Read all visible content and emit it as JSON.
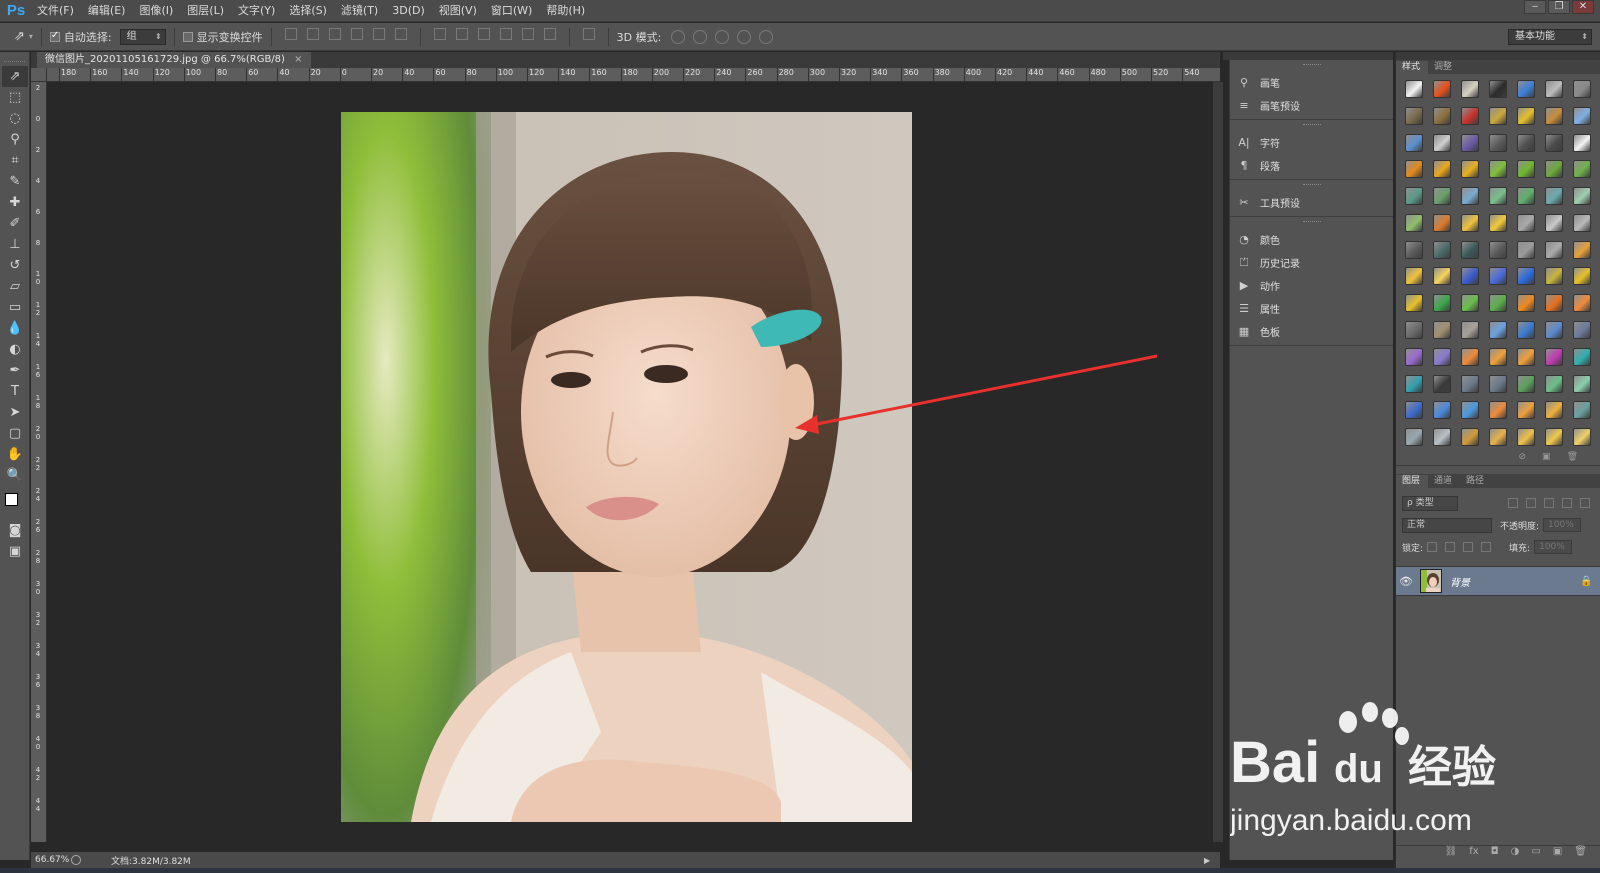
{
  "app": {
    "logo": "Ps"
  },
  "menu": [
    "文件(F)",
    "编辑(E)",
    "图像(I)",
    "图层(L)",
    "文字(Y)",
    "选择(S)",
    "滤镜(T)",
    "3D(D)",
    "视图(V)",
    "窗口(W)",
    "帮助(H)"
  ],
  "window_controls": [
    "‒",
    "❐",
    "✕"
  ],
  "options_bar": {
    "auto_select_label": "自动选择:",
    "auto_select_checked": true,
    "auto_select_value": "组",
    "show_transform_label": "显示变换控件",
    "show_transform_checked": false,
    "mode_3d_label": "3D 模式:",
    "workspace": "基本功能"
  },
  "document": {
    "tab_title": "微信图片_20201105161729.jpg @ 66.7%(RGB/8)",
    "tab_close": "×",
    "ruler_top_ticks": [
      "180",
      "160",
      "140",
      "120",
      "100",
      "80",
      "60",
      "40",
      "20",
      "0",
      "20",
      "40",
      "60",
      "80",
      "100",
      "120",
      "140",
      "160",
      "180",
      "200",
      "220",
      "240",
      "260",
      "280",
      "300",
      "320",
      "340",
      "360",
      "380",
      "400",
      "420",
      "440",
      "460",
      "480",
      "500",
      "520",
      "540"
    ],
    "ruler_left_ticks": [
      "2",
      "0",
      "2",
      "4",
      "6",
      "8",
      "1 0",
      "1 2",
      "1 4",
      "1 6",
      "1 8",
      "2 0",
      "2 2",
      "2 4",
      "2 6",
      "2 8",
      "3 0",
      "3 2",
      "3 4",
      "3 6",
      "3 8",
      "4 0",
      "4 2",
      "4 4"
    ]
  },
  "status": {
    "zoom": "66.67%",
    "doc_size": "文档:3.82M/3.82M"
  },
  "mid_panel": {
    "groups": [
      [
        {
          "icon": "brush-icon",
          "glyph": "⚲",
          "label": "画笔"
        },
        {
          "icon": "brush-presets-icon",
          "glyph": "≡",
          "label": "画笔预设"
        }
      ],
      [
        {
          "icon": "character-icon",
          "glyph": "A|",
          "label": "字符"
        },
        {
          "icon": "paragraph-icon",
          "glyph": "¶",
          "label": "段落"
        }
      ],
      [
        {
          "icon": "tool-presets-icon",
          "glyph": "✂",
          "label": "工具预设"
        }
      ],
      [
        {
          "icon": "color-icon",
          "glyph": "◔",
          "label": "颜色"
        },
        {
          "icon": "history-icon",
          "glyph": "⏍",
          "label": "历史记录"
        },
        {
          "icon": "actions-icon",
          "glyph": "▶",
          "label": "动作"
        },
        {
          "icon": "properties-icon",
          "glyph": "☰",
          "label": "属性"
        },
        {
          "icon": "swatches-icon",
          "glyph": "▦",
          "label": "色板"
        }
      ]
    ]
  },
  "styles_panel": {
    "tabs": [
      "样式",
      "调整"
    ],
    "active_tab": "样式",
    "swatch_colors": [
      "#f4f4f4",
      "#e8501a",
      "#d9d2c0",
      "#2b2b2b",
      "#3c7fd9",
      "#bdbdbd",
      "#8a8a8a",
      "#7a6a4a",
      "#8c6f3c",
      "#c8322a",
      "#caa83a",
      "#e5c02a",
      "#c98b3a",
      "#7fb0e5",
      "#5a8fd0",
      "#cfcfcf",
      "#6a5aa8",
      "#5a5a5a",
      "#4e4e4e",
      "#4a4a4a",
      "#f4f4f4",
      "#e48a1a",
      "#eaa71a",
      "#e9b01c",
      "#7fbf3a",
      "#6fb82e",
      "#6aa83a",
      "#6fb04a",
      "#5a9a8a",
      "#6aa06a",
      "#7aaad0",
      "#79c08a",
      "#5fb06a",
      "#6aaab0",
      "#9fcfaf",
      "#8fbf6a",
      "#e07a2a",
      "#f0c23a",
      "#f2c93a",
      "#a9a9a9",
      "#c9c9c9",
      "#b9b9b9",
      "#5a5a5a",
      "#4a6a6a",
      "#3a5a5a",
      "#5a5a5a",
      "#9a9a9a",
      "#aaaaaa",
      "#e8a03a",
      "#f2c33a",
      "#f6d35a",
      "#3a5ad0",
      "#4a6ae0",
      "#2a6ae0",
      "#c8b43a",
      "#e8c02a",
      "#e8c02a",
      "#3aa84a",
      "#6ac04a",
      "#5ab04a",
      "#f08a1a",
      "#e8701a",
      "#f08a3a",
      "#6a6a6a",
      "#a09070",
      "#a8a098",
      "#6aa0e0",
      "#3a7ad0",
      "#5a8ad0",
      "#6a7a9a",
      "#9a6ad0",
      "#8a7ad0",
      "#f08a3a",
      "#f0a03a",
      "#f0a03a",
      "#c03ab0",
      "#30b0b0",
      "#30a0b0",
      "#3a3a3a",
      "#6a7a8a",
      "#6a7a8a",
      "#5aa05a",
      "#6ac08a",
      "#8ad0aa",
      "#3a6ad0",
      "#4a8ae0",
      "#4a9ae0",
      "#f08a3a",
      "#f0a03a",
      "#f0b03a",
      "#6aa0a0",
      "#9aa8b0",
      "#bac0c8",
      "#d09a3a",
      "#e8b04a",
      "#f0c04a",
      "#f0c84a",
      "#f0d06a"
    ]
  },
  "layers_panel": {
    "tabs": [
      "图层",
      "通道",
      "路径"
    ],
    "active_tab": "图层",
    "filter_type": "ρ 类型",
    "blend_mode": "正常",
    "opacity_label": "不透明度:",
    "opacity_value": "100%",
    "lock_label": "锁定:",
    "fill_label": "填充:",
    "fill_value": "100%",
    "layers": [
      {
        "name": "背景",
        "visible": true,
        "locked": true
      }
    ],
    "footer_icons": [
      "link-icon",
      "fx-icon",
      "mask-icon",
      "adjustment-icon",
      "group-icon",
      "new-layer-icon",
      "trash-icon"
    ]
  },
  "watermark": {
    "brand": "Bai",
    "brand2": "du",
    "cn": "经验",
    "url": "jingyan.baidu.com"
  },
  "colors": {
    "accent_ps": "#3fa9f5",
    "selected_layer": "#6b7a8f",
    "annotation_arrow": "#e8302c"
  }
}
